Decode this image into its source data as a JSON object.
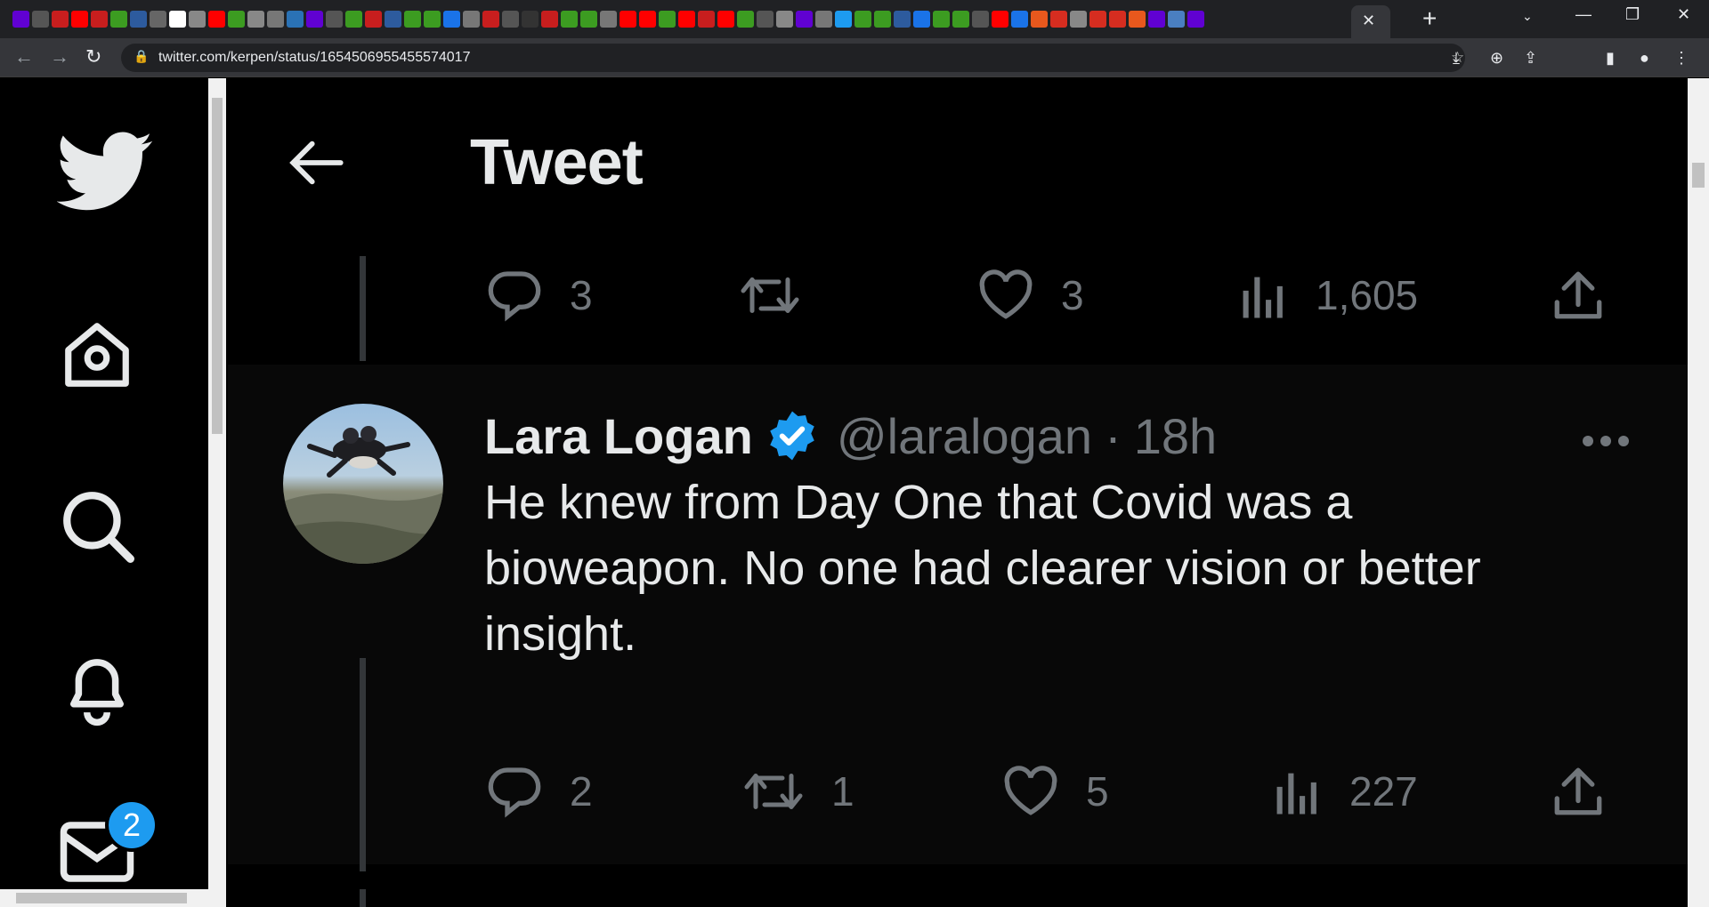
{
  "browser": {
    "url": "twitter.com/kerpen/status/1654506955455574017",
    "active_tab_close": "✕",
    "new_tab": "+",
    "tab_icons": [
      "#6001d2",
      "#555",
      "#c81e1e",
      "#ff0000",
      "#c81e1e",
      "#3c9c21",
      "#2d5b9e",
      "#666",
      "#fff",
      "#888",
      "#ff0000",
      "#3c9c21",
      "#888",
      "#777",
      "#2a72b5",
      "#6001d2",
      "#555",
      "#3c9c21",
      "#c81e1e",
      "#2d5b9e",
      "#3c9c21",
      "#3c9c21",
      "#1a73e8",
      "#777",
      "#c81e1e",
      "#555",
      "#333",
      "#c81e1e",
      "#3c9c21",
      "#3c9c21",
      "#777",
      "#ff0000",
      "#ff0000",
      "#3c9c21",
      "#ff0000",
      "#c81e1e",
      "#ff0000",
      "#3c9c21",
      "#555",
      "#888",
      "#6001d2",
      "#777",
      "#1d9bf0",
      "#3c9c21",
      "#3c9c21",
      "#2d5b9e",
      "#1a73e8",
      "#3c9c21",
      "#3c9c21",
      "#555",
      "#ff0000",
      "#1a73e8",
      "#e8581d",
      "#d62d20",
      "#888",
      "#d62d20",
      "#d62d20",
      "#e8581d",
      "#6001d2",
      "#4a7fc1",
      "#6001d2"
    ]
  },
  "header": {
    "title": "Tweet"
  },
  "parent_actions": {
    "replies": "3",
    "retweets": "",
    "likes": "3",
    "views": "1,605"
  },
  "reply_tweet": {
    "name": "Lara Logan",
    "handle": "@laralogan",
    "separator": "·",
    "time": "18h",
    "text": "He knew from Day One that Covid was a bioweapon. No one had clearer vision or better insight.",
    "replies": "2",
    "retweets": "1",
    "likes": "5",
    "views": "227"
  },
  "nav": {
    "messages_badge": "2"
  },
  "colors": {
    "accent": "#1d9bf0",
    "text_primary": "#e7e9ea",
    "text_secondary": "#71767b"
  },
  "icons": [
    "twitter-logo-icon",
    "home-icon",
    "search-icon",
    "notifications-bell-icon",
    "messages-envelope-icon",
    "back-arrow-icon",
    "reply-icon",
    "retweet-icon",
    "like-heart-icon",
    "views-icon",
    "share-icon",
    "verified-badge-icon",
    "more-options-icon"
  ]
}
